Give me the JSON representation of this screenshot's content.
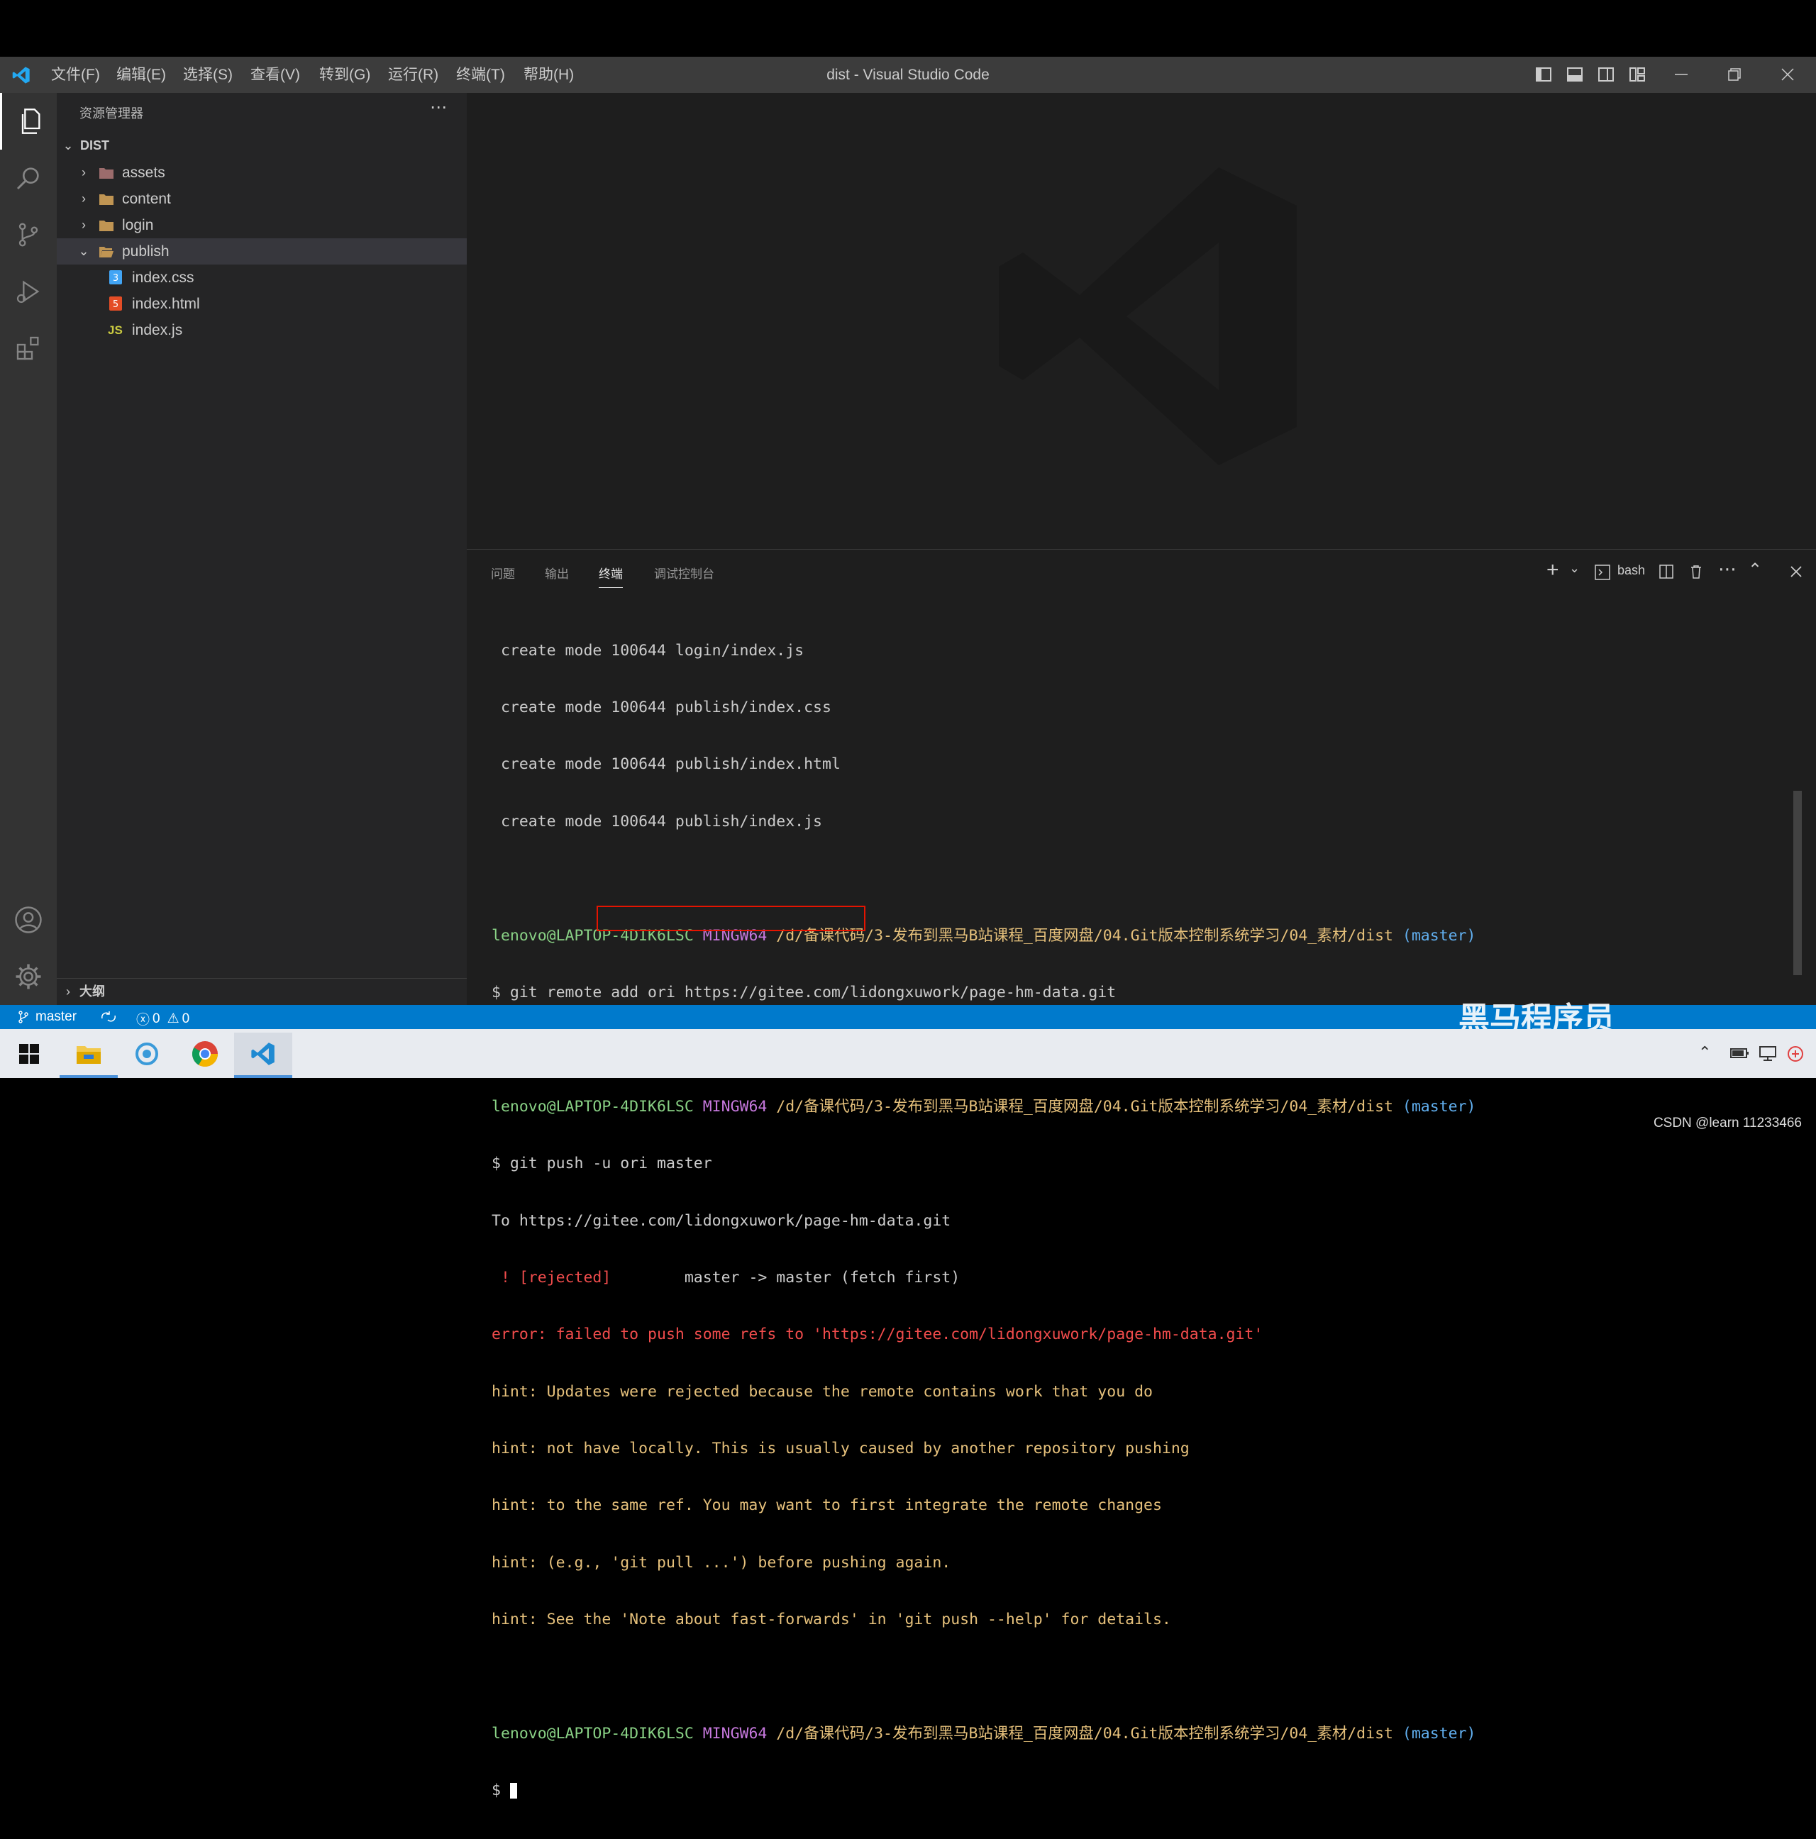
{
  "window": {
    "title": "dist - Visual Studio Code"
  },
  "menu": [
    "文件(F)",
    "编辑(E)",
    "选择(S)",
    "查看(V)",
    "转到(G)",
    "运行(R)",
    "终端(T)",
    "帮助(H)"
  ],
  "sidebar": {
    "title": "资源管理器",
    "root": "DIST",
    "items": [
      {
        "label": "assets",
        "icon": "folder-icon"
      },
      {
        "label": "content",
        "icon": "folder-icon"
      },
      {
        "label": "login",
        "icon": "folder-icon"
      },
      {
        "label": "publish",
        "icon": "folder-open-icon"
      },
      {
        "label": "index.css",
        "icon": "css-file-icon"
      },
      {
        "label": "index.html",
        "icon": "html-file-icon"
      },
      {
        "label": "index.js",
        "icon": "js-file-icon"
      }
    ],
    "outline": "大纲"
  },
  "panel": {
    "tabs": [
      "问题",
      "输出",
      "终端",
      "调试控制台"
    ],
    "active_tab": "终端",
    "shell": "bash"
  },
  "terminal": {
    "lines": [
      " create mode 100644 login/index.js",
      " create mode 100644 publish/index.css",
      " create mode 100644 publish/index.html",
      " create mode 100644 publish/index.js"
    ],
    "prompt_user": "lenovo@LAPTOP-4DIK6LSC",
    "prompt_env": "MINGW64",
    "prompt_path": "/d/备课代码/3-发布到黑马B站课程_百度网盘/04.Git版本控制系统学习/04_素材/dist",
    "prompt_branch": "(master)",
    "cmd1": "$ git remote add ori https://gitee.com/lidongxuwork/page-hm-data.git",
    "cmd2": "$ git push -u ori master",
    "out1": "To https://gitee.com/lidongxuwork/page-hm-data.git",
    "rejected": " ! [rejected]",
    "rejected_rest": "        master -> master (fetch first)",
    "error": "error: failed to push some refs to 'https://gitee.com/lidongxuwork/page-hm-data.git'",
    "hints": [
      "hint: Updates were rejected because the remote contains work that you do",
      "hint: not have locally. This is usually caused by another repository pushing",
      "hint: to the same ref. You may want to first integrate the remote changes",
      "hint: (e.g., 'git pull ...') before pushing again.",
      "hint: See the 'Note about fast-forwards' in 'git push --help' for details."
    ],
    "final_prompt": "$ "
  },
  "statusbar": {
    "branch": "master",
    "errors": "0",
    "warnings": "0"
  },
  "watermark": "黑马程序员",
  "credit": "CSDN @learn 11233466",
  "colors": {
    "accent": "#007acc",
    "highlight_box": "#e51400"
  }
}
